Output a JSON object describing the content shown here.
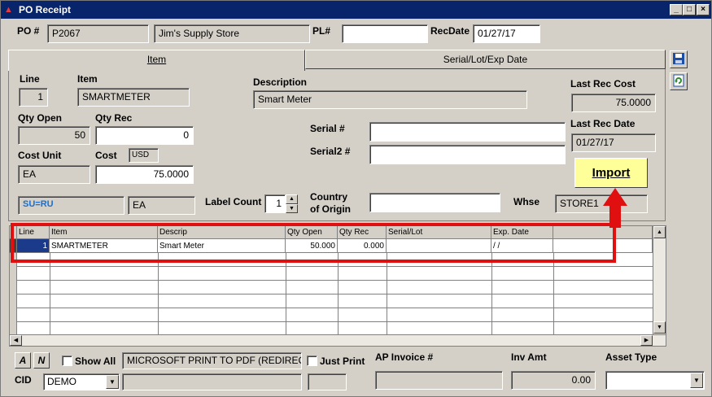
{
  "window": {
    "title": "PO Receipt"
  },
  "header": {
    "po_label": "PO #",
    "po_number": "P2067",
    "vendor_name": "Jim's Supply Store",
    "pl_label": "PL#",
    "pl_value": "",
    "recdate_label": "RecDate",
    "recdate_value": "01/27/17"
  },
  "tabs": [
    {
      "label": "Item",
      "active": true
    },
    {
      "label": "Serial/Lot/Exp Date",
      "active": false
    }
  ],
  "item": {
    "line_label": "Line",
    "line_value": "1",
    "item_label": "Item",
    "item_value": "SMARTMETER",
    "desc_label": "Description",
    "desc_value": "Smart Meter",
    "last_rec_cost_label": "Last Rec Cost",
    "last_rec_cost_value": "75.0000",
    "qty_open_label": "Qty Open",
    "qty_open_value": "50",
    "qty_rec_label": "Qty Rec",
    "qty_rec_value": "0",
    "last_rec_date_label": "Last Rec Date",
    "last_rec_date_value": "01/27/17",
    "serial_label": "Serial #",
    "serial_value": "",
    "serial2_label": "Serial2 #",
    "serial2_value": "",
    "cost_unit_label": "Cost Unit",
    "cost_unit_value": "EA",
    "cost_label": "Cost",
    "currency": "USD",
    "cost_value": "75.0000",
    "import_label": "Import",
    "conversion_value": "SU=RU",
    "unit_value": "EA",
    "label_count_label": "Label Count",
    "label_count_value": "1",
    "country_label_1": "Country",
    "country_label_2": "of Origin",
    "country_value": "",
    "whse_label": "Whse",
    "whse_value": "STORE1"
  },
  "grid": {
    "columns": [
      "Line",
      "Item",
      "Descrip",
      "Qty Open",
      "Qty Rec",
      "Serial/Lot",
      "Exp. Date",
      ""
    ],
    "rows": [
      {
        "line": "1",
        "item": "SMARTMETER",
        "descrip": "Smart Meter",
        "qty_open": "50.000",
        "qty_rec": "0.000",
        "serial": "",
        "exp_date": "/ /",
        "extra": ""
      }
    ]
  },
  "footer": {
    "a_label": "A",
    "n_label": "N",
    "show_all_label": "Show All",
    "printer_value": "MICROSOFT PRINT TO PDF (REDIREC",
    "just_print_label": "Just Print",
    "ap_invoice_label": "AP Invoice #",
    "ap_invoice_value": "",
    "inv_amt_label": "Inv Amt",
    "inv_amt_value": "0.00",
    "asset_type_label": "Asset Type",
    "asset_type_value": "",
    "cid_label": "CID",
    "cid_value": "DEMO"
  },
  "colors": {
    "title_bar": "#08246b",
    "import_button": "#ffff99",
    "highlight": "#e01010",
    "conversion_text": "#1a6fd0"
  }
}
